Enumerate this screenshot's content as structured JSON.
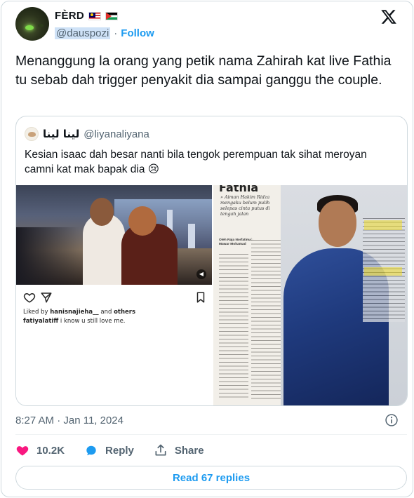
{
  "author": {
    "display_name": "FÈRD",
    "flags": [
      "malaysia-flag",
      "palestine-flag"
    ],
    "handle": "@dauspozi",
    "follow_label": "Follow"
  },
  "tweet": {
    "text": "Menanggung la orang yang petik nama Zahirah kat live Fathia tu sebab dah trigger penyakit dia sampai ganggu the couple.",
    "timestamp": "8:27 AM · Jan 11, 2024"
  },
  "quote": {
    "display_name": "لينا لينا",
    "handle": "@liyanaliyana",
    "text": "Kesian isaac dah besar nanti bila tengok perempuan tak sihat meroyan camni kat mak bapak dia 😢",
    "instagram": {
      "liked_prefix": "Liked by",
      "liked_user": "hanisnajieha__",
      "liked_and": "and",
      "liked_others": "others",
      "caption_user": "fatiyalatiff",
      "caption_text": "i know u still love me."
    },
    "magazine": {
      "title": "Fathia",
      "subtitle": "» Aiman Hakim Ridza mengaku belum pulih selepas cinta putus di tengah jalan",
      "byline": "Oleh Raja Norfatimah Mawar Mohamad"
    }
  },
  "actions": {
    "likes": "10.2K",
    "reply_label": "Reply",
    "share_label": "Share"
  },
  "read_replies_label": "Read 67 replies",
  "colors": {
    "accent": "#1d9bf0",
    "like": "#f91880",
    "text": "#0f1419",
    "muted": "#536471"
  }
}
